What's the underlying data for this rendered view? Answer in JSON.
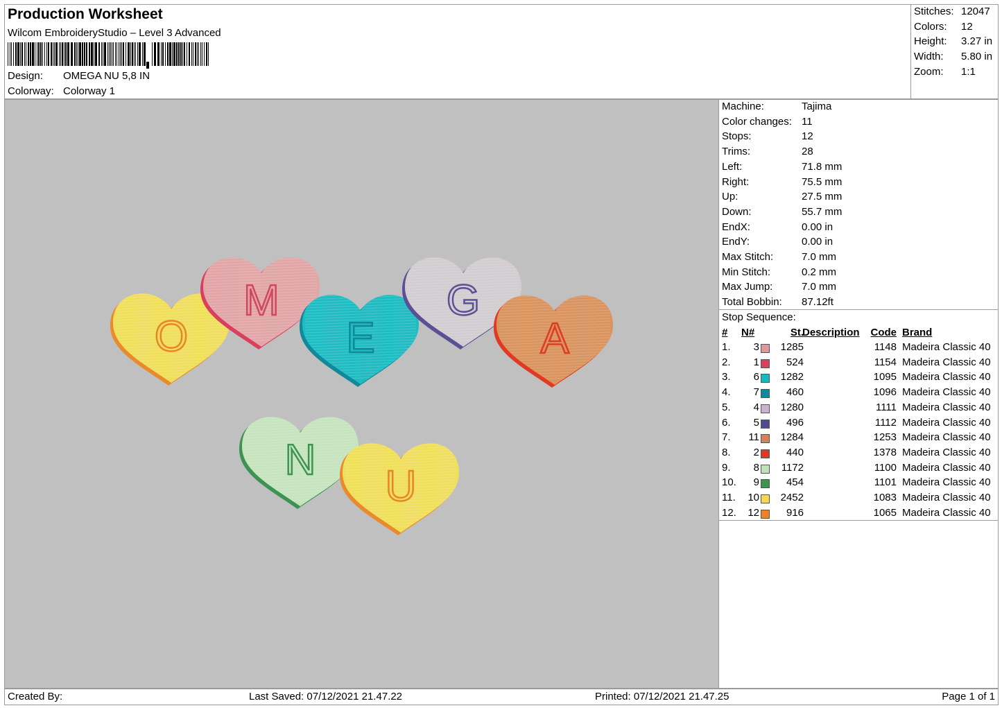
{
  "header": {
    "title": "Production Worksheet",
    "subtitle": "Wilcom EmbroideryStudio – Level 3 Advanced",
    "design_label": "Design:",
    "design_value": "OMEGA NU 5,8 IN",
    "colorway_label": "Colorway:",
    "colorway_value": "Colorway 1"
  },
  "stats": [
    {
      "label": "Stitches:",
      "value": "12047"
    },
    {
      "label": "Colors:",
      "value": "12"
    },
    {
      "label": "Height:",
      "value": "3.27 in"
    },
    {
      "label": "Width:",
      "value": "5.80 in"
    },
    {
      "label": "Zoom:",
      "value": "1:1"
    }
  ],
  "machine": [
    {
      "label": "Machine:",
      "value": "Tajima"
    },
    {
      "label": "Color changes:",
      "value": "11"
    },
    {
      "label": "Stops:",
      "value": "12"
    },
    {
      "label": "Trims:",
      "value": "28"
    },
    {
      "label": "Left:",
      "value": "71.8 mm"
    },
    {
      "label": "Right:",
      "value": "75.5 mm"
    },
    {
      "label": "Up:",
      "value": "27.5 mm"
    },
    {
      "label": "Down:",
      "value": "55.7 mm"
    },
    {
      "label": "EndX:",
      "value": "0.00 in"
    },
    {
      "label": "EndY:",
      "value": "0.00 in"
    },
    {
      "label": "Max Stitch:",
      "value": "7.0 mm"
    },
    {
      "label": "Min Stitch:",
      "value": "0.2 mm"
    },
    {
      "label": "Max Jump:",
      "value": "7.0 mm"
    },
    {
      "label": "Total Bobbin:",
      "value": "87.12ft"
    }
  ],
  "stop_sequence": {
    "title": "Stop Sequence:",
    "headers": {
      "idx": "#",
      "n": "N#",
      "st": "St.",
      "desc": "Description",
      "code": "Code",
      "brand": "Brand"
    },
    "rows": [
      {
        "idx": "1.",
        "n": "3",
        "color": "#e0989c",
        "st": "1285",
        "desc": "",
        "code": "1148",
        "brand": "Madeira Classic 40"
      },
      {
        "idx": "2.",
        "n": "1",
        "color": "#d8405e",
        "st": "524",
        "desc": "",
        "code": "1154",
        "brand": "Madeira Classic 40"
      },
      {
        "idx": "3.",
        "n": "6",
        "color": "#1ab8bf",
        "st": "1282",
        "desc": "",
        "code": "1095",
        "brand": "Madeira Classic 40"
      },
      {
        "idx": "4.",
        "n": "7",
        "color": "#12899a",
        "st": "460",
        "desc": "",
        "code": "1096",
        "brand": "Madeira Classic 40"
      },
      {
        "idx": "5.",
        "n": "4",
        "color": "#c9b2cf",
        "st": "1280",
        "desc": "",
        "code": "1111",
        "brand": "Madeira Classic 40"
      },
      {
        "idx": "6.",
        "n": "5",
        "color": "#4d4a8e",
        "st": "496",
        "desc": "",
        "code": "1112",
        "brand": "Madeira Classic 40"
      },
      {
        "idx": "7.",
        "n": "11",
        "color": "#d8805a",
        "st": "1284",
        "desc": "",
        "code": "1253",
        "brand": "Madeira Classic 40"
      },
      {
        "idx": "8.",
        "n": "2",
        "color": "#e03a22",
        "st": "440",
        "desc": "",
        "code": "1378",
        "brand": "Madeira Classic 40"
      },
      {
        "idx": "9.",
        "n": "8",
        "color": "#bfe0b8",
        "st": "1172",
        "desc": "",
        "code": "1100",
        "brand": "Madeira Classic 40"
      },
      {
        "idx": "10.",
        "n": "9",
        "color": "#3e9352",
        "st": "454",
        "desc": "",
        "code": "1101",
        "brand": "Madeira Classic 40"
      },
      {
        "idx": "11.",
        "n": "10",
        "color": "#f7d45a",
        "st": "2452",
        "desc": "",
        "code": "1083",
        "brand": "Madeira Classic 40"
      },
      {
        "idx": "12.",
        "n": "12",
        "color": "#e9842a",
        "st": "916",
        "desc": "",
        "code": "1065",
        "brand": "Madeira Classic 40"
      }
    ]
  },
  "design_preview": {
    "hearts": [
      {
        "letter": "O",
        "fill": "#f0df5c",
        "outline": "#e98a2c",
        "text_color": "#e9842a"
      },
      {
        "letter": "M",
        "fill": "#e2a6a8",
        "outline": "#d8405e",
        "text_color": "#d0485e"
      },
      {
        "letter": "E",
        "fill": "#1fbcc2",
        "outline": "#12899a",
        "text_color": "#12899a"
      },
      {
        "letter": "G",
        "fill": "#d2cdd0",
        "outline": "#5a5096",
        "text_color": "#5a5096"
      },
      {
        "letter": "A",
        "fill": "#d9945f",
        "outline": "#e03a22",
        "text_color": "#e03a22"
      },
      {
        "letter": "N",
        "fill": "#c6e4be",
        "outline": "#3e9352",
        "text_color": "#3e9352"
      },
      {
        "letter": "U",
        "fill": "#f0df5c",
        "outline": "#e98a2c",
        "text_color": "#e9842a"
      }
    ]
  },
  "footer": {
    "created_by": "Created By:",
    "last_saved": "Last Saved: 07/12/2021 21.47.22",
    "printed": "Printed: 07/12/2021 21.47.25",
    "page": "Page 1 of 1"
  }
}
